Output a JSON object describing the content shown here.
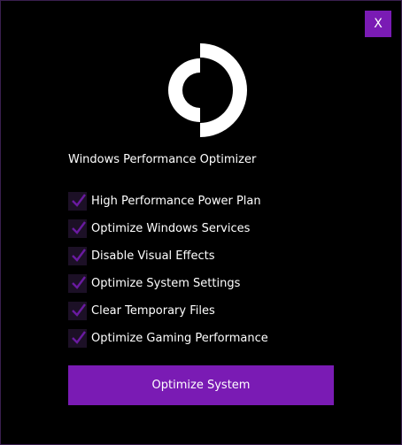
{
  "window": {
    "close_label": "X",
    "title": "Windows Performance Optimizer"
  },
  "options": [
    {
      "label": "High Performance Power Plan",
      "checked": true
    },
    {
      "label": "Optimize Windows Services",
      "checked": true
    },
    {
      "label": "Disable Visual Effects",
      "checked": true
    },
    {
      "label": "Optimize System Settings",
      "checked": true
    },
    {
      "label": "Clear Temporary Files",
      "checked": true
    },
    {
      "label": "Optimize Gaming Performance",
      "checked": true
    }
  ],
  "actions": {
    "primary_label": "Optimize System"
  },
  "icons": {
    "logo": "optimizer-logo-icon",
    "check": "check-icon"
  },
  "colors": {
    "background": "#000000",
    "accent": "#7a1bb4",
    "checkbox_bg": "#1c1026",
    "text": "#ffffff"
  }
}
